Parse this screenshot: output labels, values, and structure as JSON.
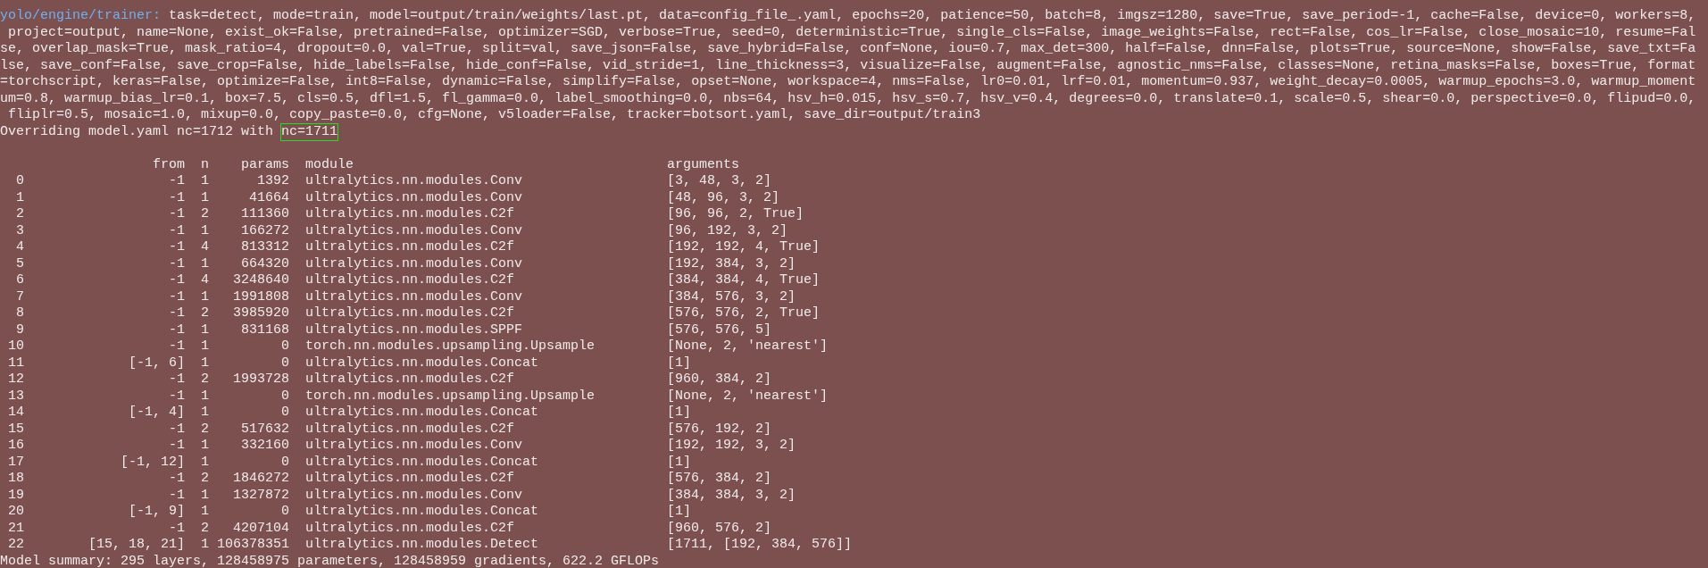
{
  "terminal": {
    "config_prefix": "yolo/engine/trainer:",
    "config_lines": [
      " task=detect, mode=train, model=output/train/weights/last.pt, data=config_file_.yaml, epochs=20, patience=50, batch=8, imgsz=1280, save=True, save_period=-1, cache=False, device=0, workers=8,",
      " project=output, name=None, exist_ok=False, pretrained=False, optimizer=SGD, verbose=True, seed=0, deterministic=True, single_cls=False, image_weights=False, rect=False, cos_lr=False, close_mosaic=10, resume=Fal",
      "se, overlap_mask=True, mask_ratio=4, dropout=0.0, val=True, split=val, save_json=False, save_hybrid=False, conf=None, iou=0.7, max_det=300, half=False, dnn=False, plots=True, source=None, show=False, save_txt=Fa",
      "lse, save_conf=False, save_crop=False, hide_labels=False, hide_conf=False, vid_stride=1, line_thickness=3, visualize=False, augment=False, agnostic_nms=False, classes=None, retina_masks=False, boxes=True, format",
      "=torchscript, keras=False, optimize=False, int8=False, dynamic=False, simplify=False, opset=None, workspace=4, nms=False, lr0=0.01, lrf=0.01, momentum=0.937, weight_decay=0.0005, warmup_epochs=3.0, warmup_moment",
      "um=0.8, warmup_bias_lr=0.1, box=7.5, cls=0.5, dfl=1.5, fl_gamma=0.0, label_smoothing=0.0, nbs=64, hsv_h=0.015, hsv_s=0.7, hsv_v=0.4, degrees=0.0, translate=0.1, scale=0.5, shear=0.0, perspective=0.0, flipud=0.0,",
      " fliplr=0.5, mosaic=1.0, mixup=0.0, copy_paste=0.0, cfg=None, v5loader=False, tracker=botsort.yaml, save_dir=output/train3"
    ],
    "override_text": "Overriding model.yaml nc=1712 with ",
    "override_highlight": "nc=1711",
    "table": {
      "columns": [
        "from",
        "n",
        "params",
        "module",
        "arguments"
      ],
      "rows": [
        {
          "index": "0",
          "from": "-1",
          "n": "1",
          "params": "1392",
          "module": "ultralytics.nn.modules.Conv",
          "arguments": "[3, 48, 3, 2]"
        },
        {
          "index": "1",
          "from": "-1",
          "n": "1",
          "params": "41664",
          "module": "ultralytics.nn.modules.Conv",
          "arguments": "[48, 96, 3, 2]"
        },
        {
          "index": "2",
          "from": "-1",
          "n": "2",
          "params": "111360",
          "module": "ultralytics.nn.modules.C2f",
          "arguments": "[96, 96, 2, True]"
        },
        {
          "index": "3",
          "from": "-1",
          "n": "1",
          "params": "166272",
          "module": "ultralytics.nn.modules.Conv",
          "arguments": "[96, 192, 3, 2]"
        },
        {
          "index": "4",
          "from": "-1",
          "n": "4",
          "params": "813312",
          "module": "ultralytics.nn.modules.C2f",
          "arguments": "[192, 192, 4, True]"
        },
        {
          "index": "5",
          "from": "-1",
          "n": "1",
          "params": "664320",
          "module": "ultralytics.nn.modules.Conv",
          "arguments": "[192, 384, 3, 2]"
        },
        {
          "index": "6",
          "from": "-1",
          "n": "4",
          "params": "3248640",
          "module": "ultralytics.nn.modules.C2f",
          "arguments": "[384, 384, 4, True]"
        },
        {
          "index": "7",
          "from": "-1",
          "n": "1",
          "params": "1991808",
          "module": "ultralytics.nn.modules.Conv",
          "arguments": "[384, 576, 3, 2]"
        },
        {
          "index": "8",
          "from": "-1",
          "n": "2",
          "params": "3985920",
          "module": "ultralytics.nn.modules.C2f",
          "arguments": "[576, 576, 2, True]"
        },
        {
          "index": "9",
          "from": "-1",
          "n": "1",
          "params": "831168",
          "module": "ultralytics.nn.modules.SPPF",
          "arguments": "[576, 576, 5]"
        },
        {
          "index": "10",
          "from": "-1",
          "n": "1",
          "params": "0",
          "module": "torch.nn.modules.upsampling.Upsample",
          "arguments": "[None, 2, 'nearest']"
        },
        {
          "index": "11",
          "from": "[-1, 6]",
          "n": "1",
          "params": "0",
          "module": "ultralytics.nn.modules.Concat",
          "arguments": "[1]"
        },
        {
          "index": "12",
          "from": "-1",
          "n": "2",
          "params": "1993728",
          "module": "ultralytics.nn.modules.C2f",
          "arguments": "[960, 384, 2]"
        },
        {
          "index": "13",
          "from": "-1",
          "n": "1",
          "params": "0",
          "module": "torch.nn.modules.upsampling.Upsample",
          "arguments": "[None, 2, 'nearest']"
        },
        {
          "index": "14",
          "from": "[-1, 4]",
          "n": "1",
          "params": "0",
          "module": "ultralytics.nn.modules.Concat",
          "arguments": "[1]"
        },
        {
          "index": "15",
          "from": "-1",
          "n": "2",
          "params": "517632",
          "module": "ultralytics.nn.modules.C2f",
          "arguments": "[576, 192, 2]"
        },
        {
          "index": "16",
          "from": "-1",
          "n": "1",
          "params": "332160",
          "module": "ultralytics.nn.modules.Conv",
          "arguments": "[192, 192, 3, 2]"
        },
        {
          "index": "17",
          "from": "[-1, 12]",
          "n": "1",
          "params": "0",
          "module": "ultralytics.nn.modules.Concat",
          "arguments": "[1]"
        },
        {
          "index": "18",
          "from": "-1",
          "n": "2",
          "params": "1846272",
          "module": "ultralytics.nn.modules.C2f",
          "arguments": "[576, 384, 2]"
        },
        {
          "index": "19",
          "from": "-1",
          "n": "1",
          "params": "1327872",
          "module": "ultralytics.nn.modules.Conv",
          "arguments": "[384, 384, 3, 2]"
        },
        {
          "index": "20",
          "from": "[-1, 9]",
          "n": "1",
          "params": "0",
          "module": "ultralytics.nn.modules.Concat",
          "arguments": "[1]"
        },
        {
          "index": "21",
          "from": "-1",
          "n": "2",
          "params": "4207104",
          "module": "ultralytics.nn.modules.C2f",
          "arguments": "[960, 576, 2]"
        },
        {
          "index": "22",
          "from": "[15, 18, 21]",
          "n": "1",
          "params": "106378351",
          "module": "ultralytics.nn.modules.Detect",
          "arguments": "[1711, [192, 384, 576]]"
        }
      ]
    },
    "summary": "Model summary: 295 layers, 128458975 parameters, 128458959 gradients, 622.2 GFLOPs"
  }
}
